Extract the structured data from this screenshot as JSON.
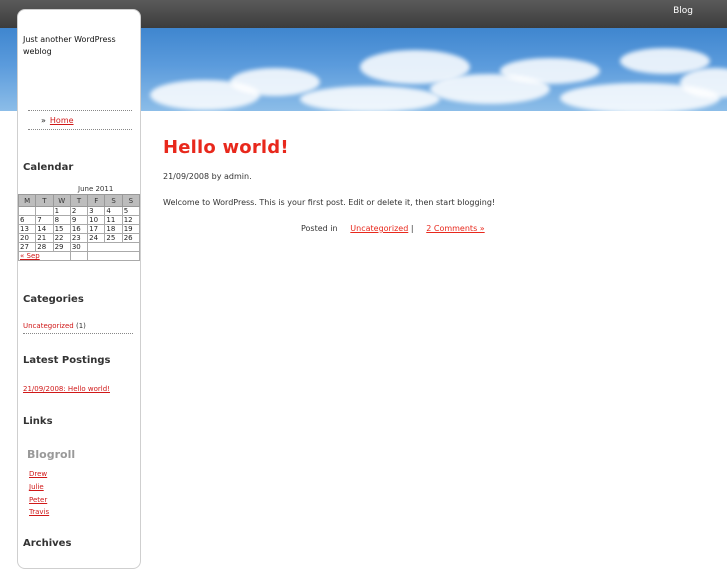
{
  "header": {
    "blog_link": "Blog"
  },
  "sidebar": {
    "tagline": "Just another WordPress weblog",
    "nav": {
      "bullet": "»",
      "home": "Home"
    },
    "calendar": {
      "heading": "Calendar",
      "caption": "June 2011",
      "days": [
        "M",
        "T",
        "W",
        "T",
        "F",
        "S",
        "S"
      ],
      "rows": [
        [
          "",
          "",
          "1",
          "2",
          "3",
          "4",
          "5"
        ],
        [
          "6",
          "7",
          "8",
          "9",
          "10",
          "11",
          "12"
        ],
        [
          "13",
          "14",
          "15",
          "16",
          "17",
          "18",
          "19"
        ],
        [
          "20",
          "21",
          "22",
          "23",
          "24",
          "25",
          "26"
        ],
        [
          "27",
          "28",
          "29",
          "30",
          "",
          "",
          ""
        ]
      ],
      "prev_link": "« Sep"
    },
    "categories": {
      "heading": "Categories",
      "item_label": "Uncategorized",
      "item_count": " (1)"
    },
    "latest": {
      "heading": "Latest Postings",
      "item": "21/09/2008: Hello world!"
    },
    "links": {
      "heading": "Links",
      "blogroll_heading": "Blogroll",
      "blogroll": [
        "Drew",
        "Julie",
        "Peter",
        "Travis"
      ]
    },
    "archives": {
      "heading": "Archives"
    }
  },
  "post": {
    "title": "Hello world!",
    "meta": "21/09/2008 by admin.",
    "body": "Welcome to WordPress. This is your first post. Edit or delete it, then start blogging!",
    "posted_in": "Posted in",
    "category": "Uncategorized",
    "separator": "|",
    "comments": "2 Comments »"
  },
  "colors": {
    "accent_red": "#e8281c",
    "topbar": "#4a4a4a",
    "sky": "#5b9bdc"
  }
}
